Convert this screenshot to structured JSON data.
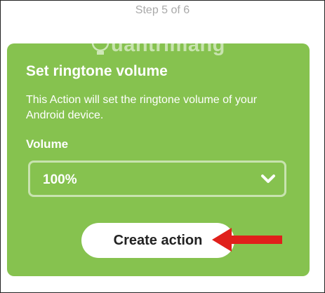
{
  "header": {
    "step_label": "Step 5 of 6"
  },
  "watermark": {
    "text": "uantrimang"
  },
  "card": {
    "title": "Set ringtone volume",
    "description": "This Action will set the ringtone volume of your Android device.",
    "field_label": "Volume",
    "select_value": "100%",
    "create_button_label": "Create action"
  },
  "colors": {
    "card_background": "#86c24f",
    "arrow": "#e0201b",
    "step_text": "#a9a9a9"
  },
  "icons": {
    "dropdown": "chevron-down-icon",
    "annotation": "red-arrow-icon",
    "watermark": "lightbulb-icon"
  }
}
